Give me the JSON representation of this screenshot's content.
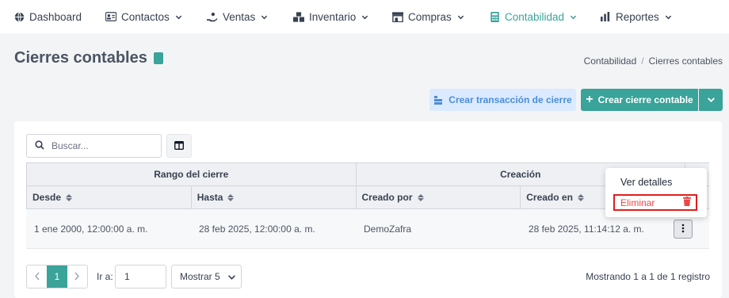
{
  "nav": {
    "items": [
      {
        "label": "Dashboard",
        "icon": "globe-icon",
        "has_dropdown": false
      },
      {
        "label": "Contactos",
        "icon": "contact-card-icon",
        "has_dropdown": true
      },
      {
        "label": "Ventas",
        "icon": "hand-sales-icon",
        "has_dropdown": true
      },
      {
        "label": "Inventario",
        "icon": "boxes-icon",
        "has_dropdown": true
      },
      {
        "label": "Compras",
        "icon": "store-icon",
        "has_dropdown": true
      },
      {
        "label": "Contabilidad",
        "icon": "calculator-icon",
        "has_dropdown": true,
        "active": true
      },
      {
        "label": "Reportes",
        "icon": "bar-chart-icon",
        "has_dropdown": true
      }
    ],
    "active_color": "#3aa39a"
  },
  "header": {
    "title": "Cierres contables",
    "title_icon": "book-icon",
    "breadcrumb": [
      "Contabilidad",
      "Cierres contables"
    ],
    "breadcrumb_separator": "/"
  },
  "actions": {
    "secondary_label": "Crear transacción de cierre",
    "primary_label": "Crear cierre contable",
    "primary_color": "#3aa39a"
  },
  "toolbar": {
    "search_placeholder": "Buscar...",
    "search_value": ""
  },
  "table": {
    "group_headers": [
      "Rango del cierre",
      "Creación"
    ],
    "columns": [
      "Desde",
      "Hasta",
      "Creado por",
      "Creado en"
    ],
    "rows": [
      [
        "1 ene 2000, 12:00:00 a. m.",
        "28 feb 2025, 12:00:00 a. m.",
        "DemoZafra",
        "28 feb 2025, 11:14:12 a. m."
      ]
    ]
  },
  "row_menu": {
    "items": [
      "Ver detalles",
      "Eliminar"
    ],
    "danger_color": "#ef4444"
  },
  "pagination": {
    "current_page": "1",
    "goto_label": "Ir a:",
    "goto_value": "1",
    "page_size_label": "Mostrar 5",
    "summary": "Mostrando 1 a 1 de 1 registro"
  }
}
